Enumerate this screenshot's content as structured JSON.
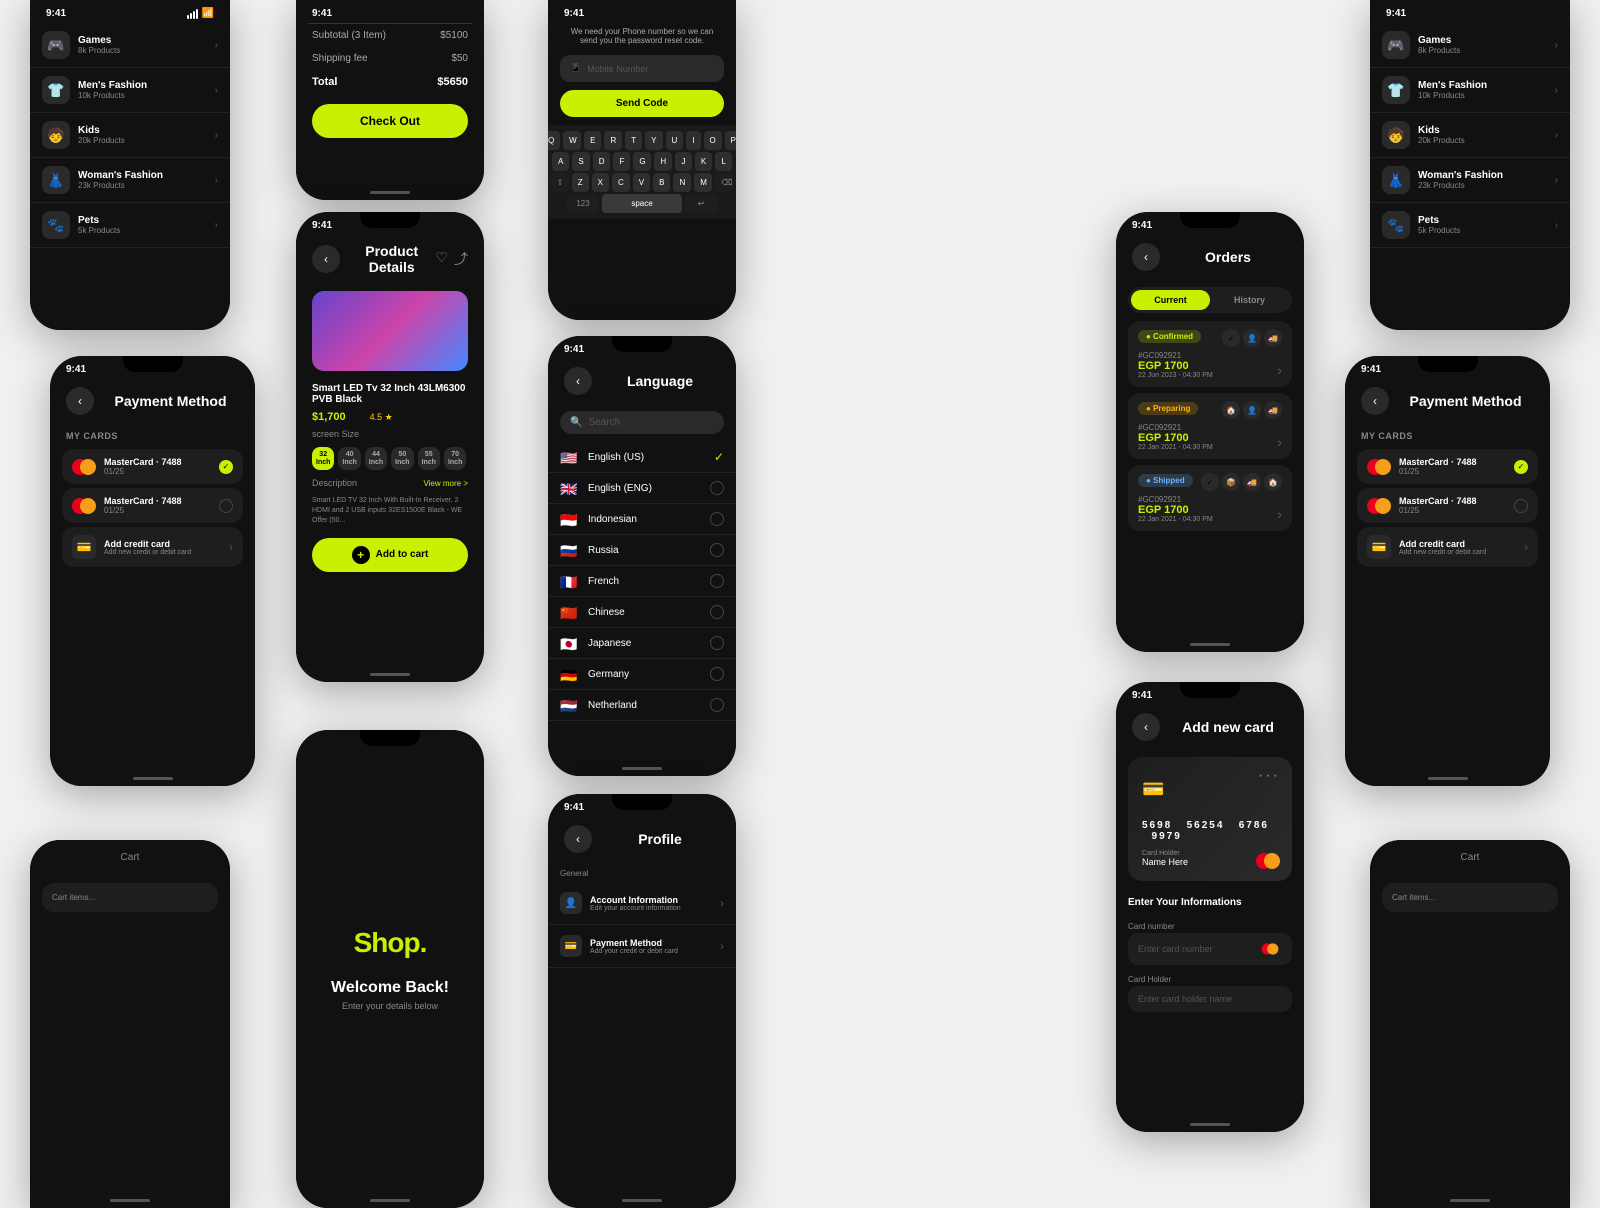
{
  "categories": {
    "items": [
      {
        "icon": "🎮",
        "name": "Games",
        "count": "8k Products"
      },
      {
        "icon": "👕",
        "name": "Men's Fashion",
        "count": "10k Products"
      },
      {
        "icon": "🧒",
        "name": "Kids",
        "count": "20k Products"
      },
      {
        "icon": "👗",
        "name": "Woman's Fashion",
        "count": "23k Products"
      },
      {
        "icon": "🐾",
        "name": "Pets",
        "count": "5k Products"
      }
    ]
  },
  "checkout": {
    "subtotal_label": "Subtotal (3 Item)",
    "subtotal_value": "$5100",
    "shipping_label": "Shipping fee",
    "shipping_value": "$50",
    "total_label": "Total",
    "total_value": "$5650",
    "button": "Check Out"
  },
  "product": {
    "screen_title": "Product Details",
    "name": "Smart LED Tv 32 Inch 43LM6300 PVB Black",
    "price": "$1,700",
    "rating": "4.5 ★",
    "size_label": "screen Size",
    "sizes": [
      "32 Inch",
      "40 Inch",
      "44 Inch",
      "50 Inch",
      "55 Inch",
      "70 Inch"
    ],
    "active_size": "32 Inch",
    "desc_label": "Description",
    "view_more": "View more >",
    "description": "Smart LED TV 32 Inch With Built-In Receiver, 2 HDMI and 2 USB inputs 32ES1500E Black - WE Offer (50...",
    "add_to_cart": "Add to cart"
  },
  "password_reset": {
    "message": "We need your Phone number so we can send you the password reset code.",
    "placeholder": "Mobile Number",
    "button": "Send Code"
  },
  "language": {
    "screen_title": "Language",
    "search_placeholder": "Search",
    "languages": [
      {
        "flag": "🇺🇸",
        "name": "English (US)",
        "selected": true
      },
      {
        "flag": "🇬🇧",
        "name": "English (ENG)",
        "selected": false
      },
      {
        "flag": "🇮🇩",
        "name": "Indonesian",
        "selected": false
      },
      {
        "flag": "🇷🇺",
        "name": "Russia",
        "selected": false
      },
      {
        "flag": "🇫🇷",
        "name": "French",
        "selected": false
      },
      {
        "flag": "🇨🇳",
        "name": "Chinese",
        "selected": false
      },
      {
        "flag": "🇯🇵",
        "name": "Japanese",
        "selected": false
      },
      {
        "flag": "🇩🇪",
        "name": "Germany",
        "selected": false
      },
      {
        "flag": "🇳🇱",
        "name": "Netherland",
        "selected": false
      }
    ]
  },
  "payment": {
    "screen_title": "Payment Method",
    "section": "MY CARDS",
    "cards": [
      {
        "name": "MasterCard · 7488",
        "expiry": "01/25",
        "active": true
      },
      {
        "name": "MasterCard · 7488",
        "expiry": "01/25",
        "active": false
      }
    ],
    "add_label": "Add credit card",
    "add_sub": "Add new credit or debit card"
  },
  "orders": {
    "screen_title": "Orders",
    "tab_current": "Current",
    "tab_history": "History",
    "orders": [
      {
        "status": "Confirmed",
        "id": "#GC092921",
        "price": "EGP 1700",
        "date": "22 Jun 2023 - 04:30 PM",
        "badge_class": "badge-confirmed"
      },
      {
        "status": "Preparing",
        "id": "#GC092921",
        "price": "EGP 1700",
        "date": "22 Jan 2021 - 04:30 PM",
        "badge_class": "badge-preparing"
      },
      {
        "status": "Shipped",
        "id": "#GC092921",
        "price": "EGP 1700",
        "date": "22 Jan 2021 - 04:30 PM",
        "badge_class": "badge-shipped"
      }
    ]
  },
  "addcard": {
    "screen_title": "Add new card",
    "card_number_parts": [
      "5698",
      "56254",
      "6786",
      "9979"
    ],
    "card_holder_label": "Card Holder",
    "card_holder": "Name Here",
    "section_title": "Enter Your Informations",
    "field1_label": "Card number",
    "field2_label": "Card Holder"
  },
  "welcome": {
    "logo": "Shop",
    "logo_dot": ".",
    "title": "Welcome Back!",
    "subtitle": "Enter your details below"
  },
  "profile": {
    "screen_title": "Profile",
    "section": "General",
    "items": [
      {
        "icon": "👤",
        "label": "Account Information",
        "sub": "Edit your account information"
      },
      {
        "icon": "💳",
        "label": "Payment Method",
        "sub": "Add your credit or debit card"
      }
    ]
  },
  "status_bar": {
    "time": "9:41"
  }
}
